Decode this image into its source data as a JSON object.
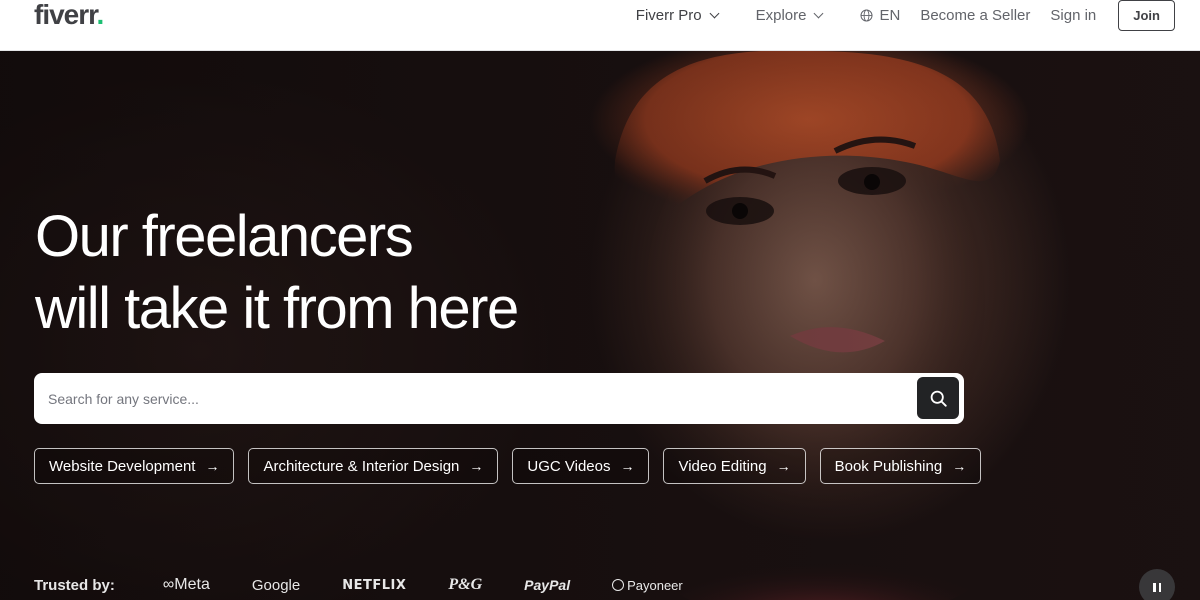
{
  "header": {
    "logo_text": "fiverr",
    "logo_dot": ".",
    "nav": {
      "fiverr_pro": "Fiverr Pro",
      "explore": "Explore",
      "language": "EN",
      "become_seller": "Become a Seller",
      "sign_in": "Sign in",
      "join": "Join"
    }
  },
  "hero": {
    "headline_line1": "Our freelancers",
    "headline_line2": "will take it from here",
    "search": {
      "placeholder": "Search for any service..."
    },
    "chips": [
      {
        "label": "Website Development"
      },
      {
        "label": "Architecture & Interior Design"
      },
      {
        "label": "UGC Videos"
      },
      {
        "label": "Video Editing"
      },
      {
        "label": "Book Publishing"
      }
    ],
    "chip_arrow": "→",
    "trusted_label": "Trusted by:",
    "brands": {
      "meta": "∞Meta",
      "google": "Google",
      "netflix": "NETFLIX",
      "pg": "P&G",
      "paypal": "PayPal",
      "payoneer": "Payoneer"
    }
  },
  "colors": {
    "brand_green": "#1dbf73",
    "text_dark": "#404145",
    "text_muted": "#62646a",
    "search_button": "#222325"
  },
  "icons": {
    "search": "search-icon",
    "globe": "globe-icon",
    "chevron": "chevron-down-icon",
    "arrow": "arrow-right-icon",
    "pause": "pause-icon"
  }
}
